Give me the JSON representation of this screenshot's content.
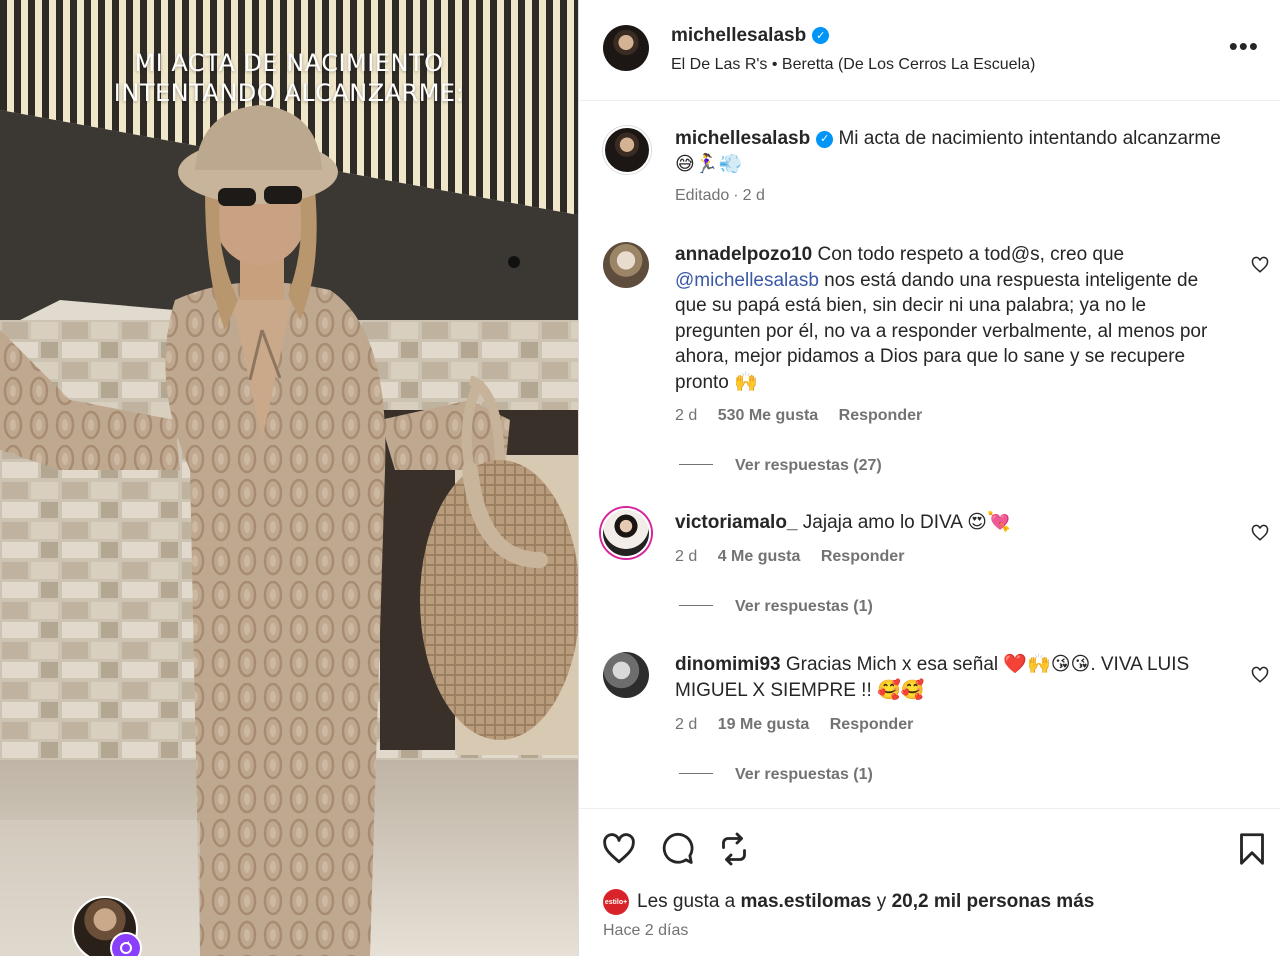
{
  "media": {
    "overlay_line1": "MI ACTA DE NACIMIENTO",
    "overlay_line2": "INTENTANDO ALCANZARME:",
    "badge_icon": "reels-icon"
  },
  "header": {
    "username": "michellesalasb",
    "location": "El De Las R's • Beretta (De Los Cerros La Escuela)",
    "more_label": "•••"
  },
  "caption": {
    "username": "michellesalasb",
    "text": "Mi acta de nacimiento intentando alcanzarme 😅🏃‍♀️💨",
    "edited": "Editado",
    "time": "2 d"
  },
  "comments": [
    {
      "username": "annadelpozo10",
      "text_before": "Con todo respeto a tod@s, creo que ",
      "mention": "@michellesalasb",
      "text_after": " nos está dando una respuesta inteligente de que su papá está bien, sin decir ni una palabra; ya no le pregunten por él, no va a responder verbalmente, al menos por ahora, mejor pidamos a Dios para que lo sane y se recupere pronto 🙌",
      "time": "2 d",
      "likes": "530 Me gusta",
      "reply": "Responder",
      "view_replies": "Ver respuestas (27)"
    },
    {
      "username": "victoriamalo_",
      "text_before": "Jajaja amo lo DIVA 😍💘",
      "mention": "",
      "text_after": "",
      "time": "2 d",
      "likes": "4 Me gusta",
      "reply": "Responder",
      "view_replies": "Ver respuestas (1)"
    },
    {
      "username": "dinomimi93",
      "text_before": "Gracias Mich x esa señal ❤️🙌😘😘. VIVA LUIS MIGUEL X SIEMPRE !! 🥰🥰",
      "mention": "",
      "text_after": "",
      "time": "2 d",
      "likes": "19 Me gusta",
      "reply": "Responder",
      "view_replies": "Ver respuestas (1)"
    }
  ],
  "footer": {
    "liker_avatar_text": "estilo+",
    "likes_prefix": "Les gusta a ",
    "liker": "mas.estilomas",
    "likes_mid": " y ",
    "likes_count": "20,2 mil personas más",
    "time": "Hace 2 días"
  },
  "colors": {
    "accent": "#0095f6",
    "mention": "#3a58a8",
    "muted": "#737373",
    "story_ring": "#d6249f"
  }
}
